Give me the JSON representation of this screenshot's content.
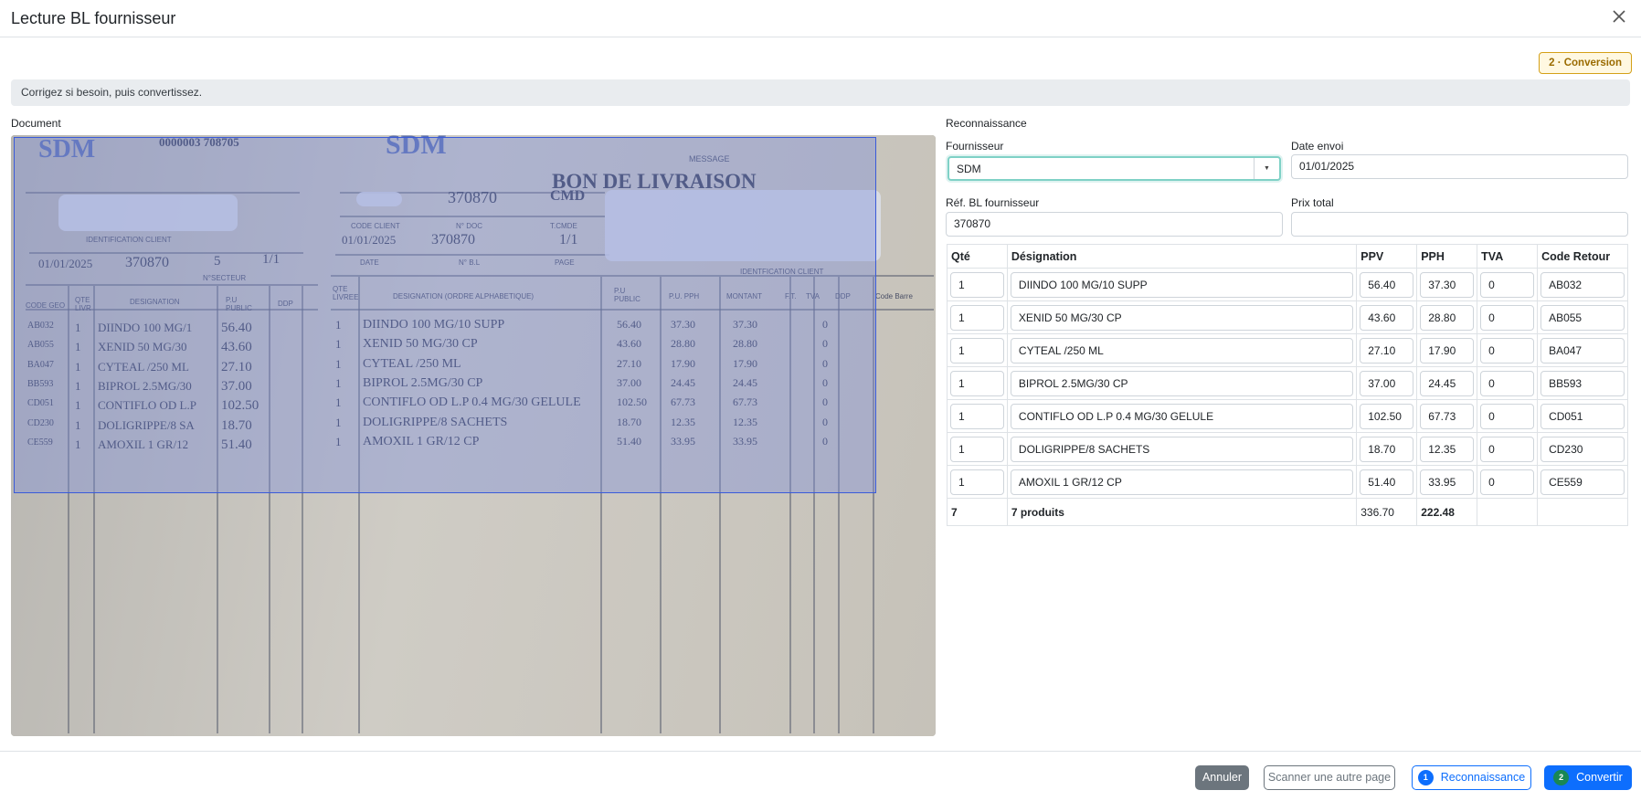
{
  "header": {
    "title": "Lecture BL fournisseur",
    "close_icon": "close-icon"
  },
  "step_badge": "2 · Conversion",
  "alert": "Corrigez si besoin, puis convertissez.",
  "sections": {
    "document": "Document",
    "reconnaissance": "Reconnaissance"
  },
  "form": {
    "fournisseur_label": "Fournisseur",
    "fournisseur_value": "SDM",
    "date_label": "Date envoi",
    "date_value": "01/01/2025",
    "ref_label": "Réf. BL fournisseur",
    "ref_value": "370870",
    "prix_label": "Prix total",
    "prix_value": ""
  },
  "table": {
    "headers": [
      "Qté",
      "Désignation",
      "PPV",
      "PPH",
      "TVA",
      "Code Retour"
    ],
    "rows": [
      {
        "qte": "1",
        "designation": "DIINDO 100 MG/10 SUPP",
        "ppv": "56.40",
        "pph": "37.30",
        "tva": "0",
        "code": "AB032"
      },
      {
        "qte": "1",
        "designation": "XENID 50 MG/30 CP",
        "ppv": "43.60",
        "pph": "28.80",
        "tva": "0",
        "code": "AB055"
      },
      {
        "qte": "1",
        "designation": "CYTEAL /250 ML",
        "ppv": "27.10",
        "pph": "17.90",
        "tva": "0",
        "code": "BA047"
      },
      {
        "qte": "1",
        "designation": "BIPROL 2.5MG/30 CP",
        "ppv": "37.00",
        "pph": "24.45",
        "tva": "0",
        "code": "BB593"
      },
      {
        "qte": "1",
        "designation": "CONTIFLO OD L.P 0.4 MG/30 GELULE",
        "ppv": "102.50",
        "pph": "67.73",
        "tva": "0",
        "code": "CD051"
      },
      {
        "qte": "1",
        "designation": "DOLIGRIPPE/8 SACHETS",
        "ppv": "18.70",
        "pph": "12.35",
        "tva": "0",
        "code": "CD230"
      },
      {
        "qte": "1",
        "designation": "AMOXIL 1 GR/12 CP",
        "ppv": "51.40",
        "pph": "33.95",
        "tva": "0",
        "code": "CE559"
      }
    ],
    "total": {
      "qte": "7",
      "designation": "7 produits",
      "ppv": "336.70",
      "pph": "222.48"
    }
  },
  "document": {
    "top_left_number": "0000003   708705",
    "bon_title": "BON DE LIVRAISON",
    "message": "MESSAGE",
    "cmd": "CMD",
    "number": "370870",
    "date": "01/01/2025",
    "page": "1/1",
    "secteur": "5",
    "ident_client": "IDENTIFICATION CLIENT",
    "ident_client2": "IDENTFICATION CLIENT",
    "col_code_client": "CODE CLIENT",
    "col_ndoc": "N° DOC",
    "col_tcmde": "T.CMDE",
    "col_date": "DATE",
    "col_nbl": "N° B.L",
    "col_page": "PAGE",
    "col_nsecteur": "N°SECTEUR",
    "header_left": [
      "CODE GEO",
      "QTE LIVR",
      "DESIGNATION",
      "P.U PUBLIC",
      "DDP"
    ],
    "header_right": [
      "QTE LIVREE",
      "DESIGNATION (ORDRE ALPHABETIQUE)",
      "P.U PUBLIC",
      "P.U. PPH",
      "MONTANT",
      "F.T.",
      "TVA",
      "DDP",
      "Code Barre"
    ],
    "left_rows": [
      {
        "code": "AB032",
        "qte": "1",
        "des": "DIINDO 100 MG/1",
        "pu": "56.40"
      },
      {
        "code": "AB055",
        "qte": "1",
        "des": "XENID 50 MG/30",
        "pu": "43.60"
      },
      {
        "code": "BA047",
        "qte": "1",
        "des": "CYTEAL /250 ML",
        "pu": "27.10"
      },
      {
        "code": "BB593",
        "qte": "1",
        "des": "BIPROL 2.5MG/30",
        "pu": "37.00"
      },
      {
        "code": "CD051",
        "qte": "1",
        "des": "CONTIFLO OD L.P",
        "pu": "102.50"
      },
      {
        "code": "CD230",
        "qte": "1",
        "des": "DOLIGRIPPE/8 SA",
        "pu": "18.70"
      },
      {
        "code": "CE559",
        "qte": "1",
        "des": "AMOXIL 1 GR/12",
        "pu": "51.40"
      }
    ],
    "right_rows": [
      {
        "qte": "1",
        "des": "DIINDO 100 MG/10 SUPP",
        "pu": "56.40",
        "pph": "37.30",
        "mnt": "37.30",
        "tva": "0"
      },
      {
        "qte": "1",
        "des": "XENID 50 MG/30 CP",
        "pu": "43.60",
        "pph": "28.80",
        "mnt": "28.80",
        "tva": "0"
      },
      {
        "qte": "1",
        "des": "CYTEAL /250 ML",
        "pu": "27.10",
        "pph": "17.90",
        "mnt": "17.90",
        "tva": "0"
      },
      {
        "qte": "1",
        "des": "BIPROL 2.5MG/30 CP",
        "pu": "37.00",
        "pph": "24.45",
        "mnt": "24.45",
        "tva": "0"
      },
      {
        "qte": "1",
        "des": "CONTIFLO OD L.P 0.4 MG/30 GELULE",
        "pu": "102.50",
        "pph": "67.73",
        "mnt": "67.73",
        "tva": "0"
      },
      {
        "qte": "1",
        "des": "DOLIGRIPPE/8 SACHETS",
        "pu": "18.70",
        "pph": "12.35",
        "mnt": "12.35",
        "tva": "0"
      },
      {
        "qte": "1",
        "des": "AMOXIL 1 GR/12 CP",
        "pu": "51.40",
        "pph": "33.95",
        "mnt": "33.95",
        "tva": "0"
      }
    ]
  },
  "footer": {
    "cancel": "Annuler",
    "scan": "Scanner une autre page",
    "reco_num": "1",
    "reco": "Reconnaissance",
    "conv_num": "2",
    "conv": "Convertir"
  },
  "colors": {
    "primary": "#0d6efd",
    "secondary": "#6c757d",
    "success": "#198754",
    "warning_border": "#d4a017"
  }
}
